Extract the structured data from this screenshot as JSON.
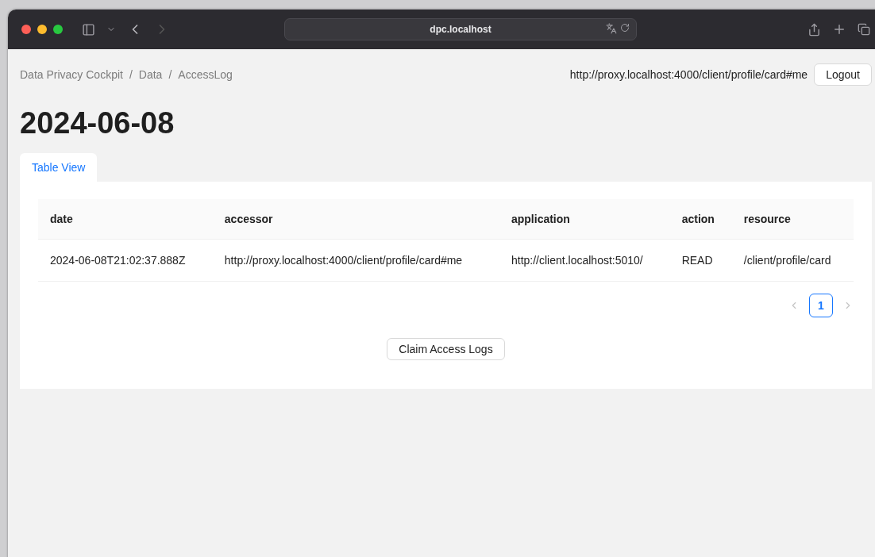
{
  "browser": {
    "address": "dpc.localhost",
    "back_disabled": false,
    "forward_disabled": true
  },
  "breadcrumb": [
    "Data Privacy Cockpit",
    "Data",
    "AccessLog"
  ],
  "breadcrumb_separator": "/",
  "user": "http://proxy.localhost:4000/client/profile/card#me",
  "logout": "Logout",
  "title": "2024-06-08",
  "tabs": [
    {
      "label": "Table View",
      "selected": true
    }
  ],
  "table": {
    "columns": [
      "date",
      "accessor",
      "application",
      "action",
      "resource"
    ],
    "rows": [
      [
        "2024-06-08T21:02:37.888Z",
        "http://proxy.localhost:4000/client/profile/card#me",
        "http://client.localhost:5010/",
        "READ",
        "/client/profile/card"
      ]
    ]
  },
  "pagination": {
    "prev_disabled": true,
    "next_disabled": true,
    "pages": [
      {
        "label": "1",
        "selected": true
      }
    ]
  },
  "claim_button": "Claim Access Logs"
}
